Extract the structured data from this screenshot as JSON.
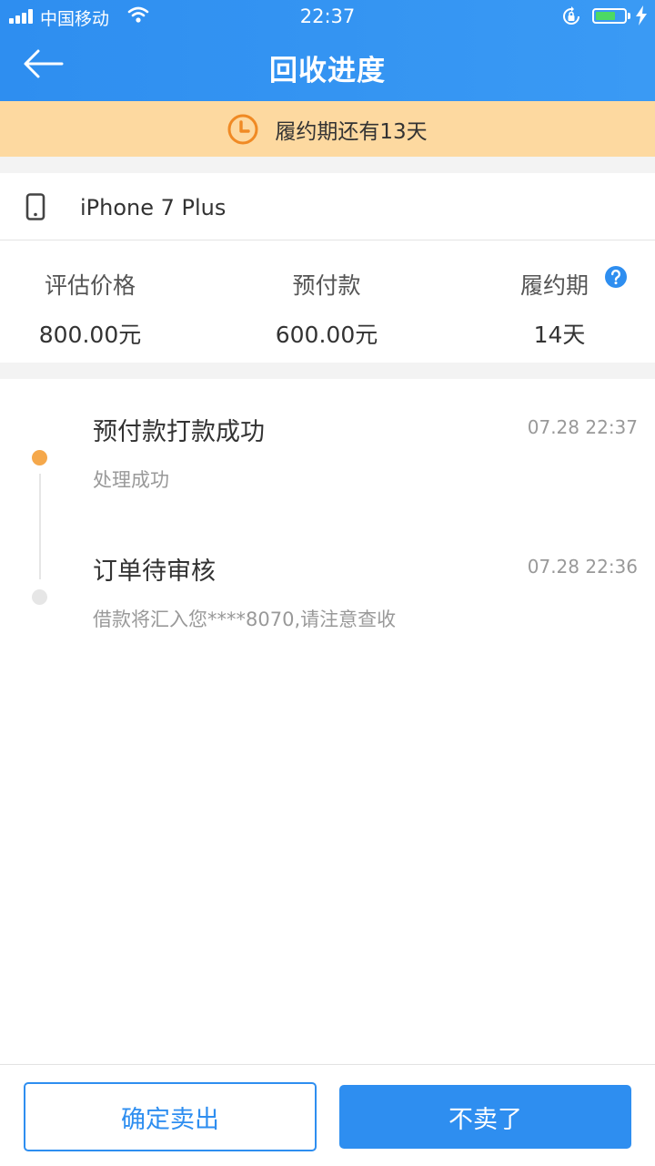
{
  "status_bar": {
    "carrier": "中国移动",
    "time": "22:37",
    "battery_level_fraction": 0.7
  },
  "nav": {
    "title": "回收进度",
    "back_icon": "arrow-left-icon"
  },
  "notice": {
    "icon": "clock-icon",
    "text": "履约期还有13天"
  },
  "device": {
    "icon": "phone-icon",
    "name": "iPhone 7 Plus"
  },
  "stats": [
    {
      "label": "评估价格",
      "value": "800.00元"
    },
    {
      "label": "预付款",
      "value": "600.00元"
    },
    {
      "label": "履约期",
      "value": "14天",
      "help_icon": "question-circle-icon"
    }
  ],
  "timeline": [
    {
      "title": "预付款打款成功",
      "time": "07.28 22:37",
      "desc": "处理成功",
      "state": "active"
    },
    {
      "title": "订单待审核",
      "time": "07.28 22:36",
      "desc": "借款将汇入您****8070,请注意查收",
      "state": "done"
    }
  ],
  "actions": {
    "confirm_label": "确定卖出",
    "cancel_label": "不卖了"
  },
  "colors": {
    "primary": "#2e8ef0",
    "notice_bg": "#fdd9a0",
    "notice_icon": "#f08a24",
    "timeline_active": "#f5a84b",
    "timeline_inactive": "#e6e6e6"
  }
}
